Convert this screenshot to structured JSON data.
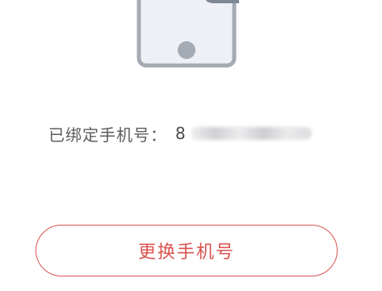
{
  "bound_phone": {
    "label": "已绑定手机号：",
    "visible_prefix": "8"
  },
  "actions": {
    "change_phone_label": "更换手机号"
  },
  "icons": {
    "illustration": "phone-icon"
  },
  "colors": {
    "accent": "#d9534f",
    "icon_stroke": "#a5abb5",
    "icon_fill": "#eef0f5"
  }
}
